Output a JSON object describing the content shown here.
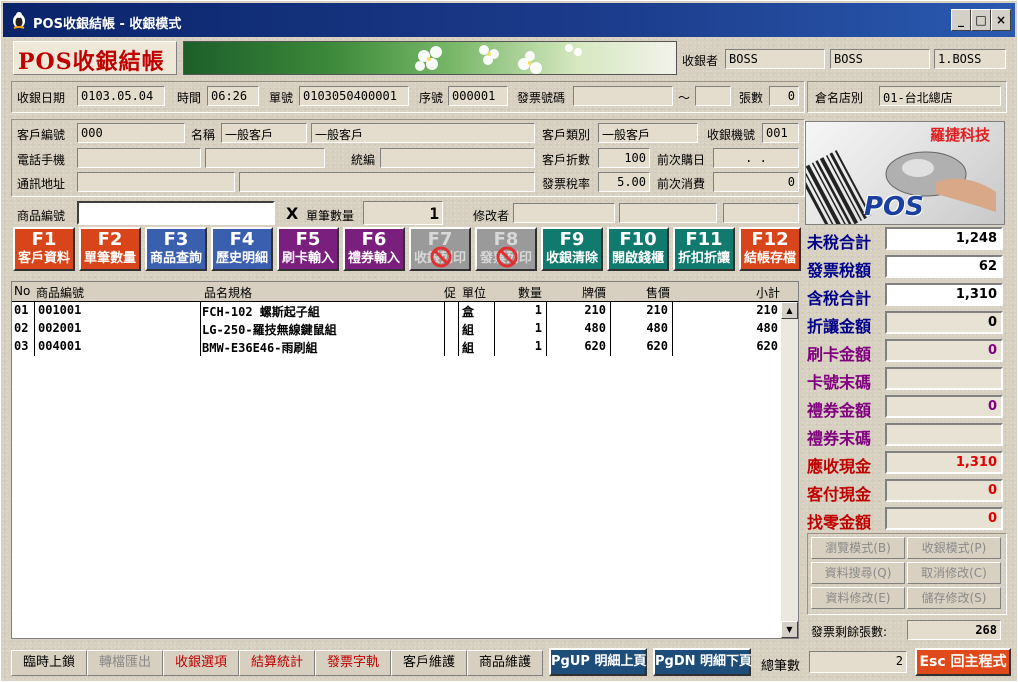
{
  "window": {
    "title": "POS收銀結帳 - 收銀模式",
    "btn_min": "_",
    "btn_max": "□",
    "btn_close": "×"
  },
  "banner": {
    "title": "POS收銀結帳",
    "cashier_label": "收銀者",
    "cashier_1": "BOSS",
    "cashier_2": "BOSS",
    "cashier_3": "1.BOSS"
  },
  "row1": {
    "date_label": "收銀日期",
    "date": "0103.05.04",
    "time_label": "時間",
    "time": "06:26",
    "order_label": "單號",
    "order": "0103050400001",
    "seq_label": "序號",
    "seq": "000001",
    "invoice_label": "發票號碼",
    "invoice_from": "",
    "tilde": "～",
    "invoice_to": "",
    "sheets_label": "張數",
    "sheets": "0",
    "store_label": "倉名店別",
    "store": "01-台北總店"
  },
  "customer": {
    "code_label": "客戶編號",
    "code": "000",
    "name_label": "名稱",
    "name_short": "一般客戶",
    "name_full": "一般客戶",
    "type_label": "客戶類別",
    "type": "一般客戶",
    "machine_label": "收銀機號",
    "machine": "001",
    "phone_label": "電話手機",
    "phone1": "",
    "phone2": "",
    "tax_label": "統編",
    "tax_id": "",
    "discount_label": "客戶折數",
    "discount": "100",
    "last_date_label": "前次購日",
    "last_date": ".  .",
    "addr_label": "通訊地址",
    "addr1": "",
    "addr2": "",
    "tax_rate_label": "發票稅率",
    "tax_rate": "5.00",
    "last_spend_label": "前次消費",
    "last_spend": "0"
  },
  "entry": {
    "product_label": "商品編號",
    "product_value": "",
    "x": "X",
    "qty_label": "單筆數量",
    "qty": "1",
    "editor_label": "修改者"
  },
  "fkeys": [
    {
      "key": "F1",
      "label": "客戶資料",
      "color": "#d9451a"
    },
    {
      "key": "F2",
      "label": "單筆數量",
      "color": "#d9451a"
    },
    {
      "key": "F3",
      "label": "商品查詢",
      "color": "#3a5fae"
    },
    {
      "key": "F4",
      "label": "歷史明細",
      "color": "#3a5fae"
    },
    {
      "key": "F5",
      "label": "刷卡輸入",
      "color": "#7a1f7e"
    },
    {
      "key": "F6",
      "label": "禮券輸入",
      "color": "#7a1f7e"
    },
    {
      "key": "F7",
      "label": "收銀列印",
      "color": "#9a9a9a"
    },
    {
      "key": "F8",
      "label": "發票列印",
      "color": "#9a9a9a"
    },
    {
      "key": "F9",
      "label": "收銀清除",
      "color": "#117a6e"
    },
    {
      "key": "F10",
      "label": "開啟錢櫃",
      "color": "#117a6e"
    },
    {
      "key": "F11",
      "label": "折扣折讓",
      "color": "#117a6e"
    },
    {
      "key": "F12",
      "label": "結帳存檔",
      "color": "#d9451a"
    }
  ],
  "table": {
    "headers": {
      "no": "No",
      "code": "商品編號",
      "name": "品名規格",
      "promo": "促",
      "unit": "單位",
      "qty": "數量",
      "list": "牌價",
      "price": "售價",
      "subtotal": "小計"
    },
    "rows": [
      {
        "no": "01",
        "code": "001001",
        "name": "FCH-102 螺斯起子組",
        "unit": "盒",
        "qty": "1",
        "list": "210",
        "price": "210",
        "subtotal": "210"
      },
      {
        "no": "02",
        "code": "002001",
        "name": "LG-250-羅技無線鍵鼠組",
        "unit": "組",
        "qty": "1",
        "list": "480",
        "price": "480",
        "subtotal": "480"
      },
      {
        "no": "03",
        "code": "004001",
        "name": "BMW-E36E46-雨刷組",
        "unit": "組",
        "qty": "1",
        "list": "620",
        "price": "620",
        "subtotal": "620"
      }
    ]
  },
  "logo": {
    "company": "羅捷科技",
    "pos": "POS"
  },
  "totals": {
    "pretax_label": "未稅合計",
    "pretax": "1,248",
    "tax_label": "發票稅額",
    "tax": "62",
    "taxed_label": "含稅合計",
    "taxed": "1,310",
    "discount_label": "折讓金額",
    "discount": "0",
    "card_label": "刷卡金額",
    "card": "0",
    "card_tail_label": "卡號末碼",
    "card_tail": "",
    "voucher_label": "禮券金額",
    "voucher": "0",
    "voucher_tail_label": "禮券末碼",
    "voucher_tail": "",
    "due_label": "應收現金",
    "due": "1,310",
    "paid_label": "客付現金",
    "paid": "0",
    "change_label": "找零金額",
    "change": "0"
  },
  "modes": {
    "browse": "瀏覽模式(B)",
    "cashier": "收銀模式(P)",
    "search": "資料搜尋(Q)",
    "cancel": "取消修改(C)",
    "edit": "資料修改(E)",
    "save": "儲存修改(S)"
  },
  "invoice_remaining_label": "發票剩餘張數:",
  "invoice_remaining": "268",
  "bottom": {
    "lock": "臨時上鎖",
    "transfer": "轉檔匯出",
    "options": "收銀選項",
    "stats": "結算統計",
    "invoice_track": "發票字軌",
    "customer_maint": "客戶維護",
    "product_maint": "商品維護",
    "pgup": "PgUP 明細上頁",
    "pgdn": "PgDN 明細下頁",
    "count_label": "總筆數",
    "count": "2",
    "esc": "Esc 回主程式"
  }
}
